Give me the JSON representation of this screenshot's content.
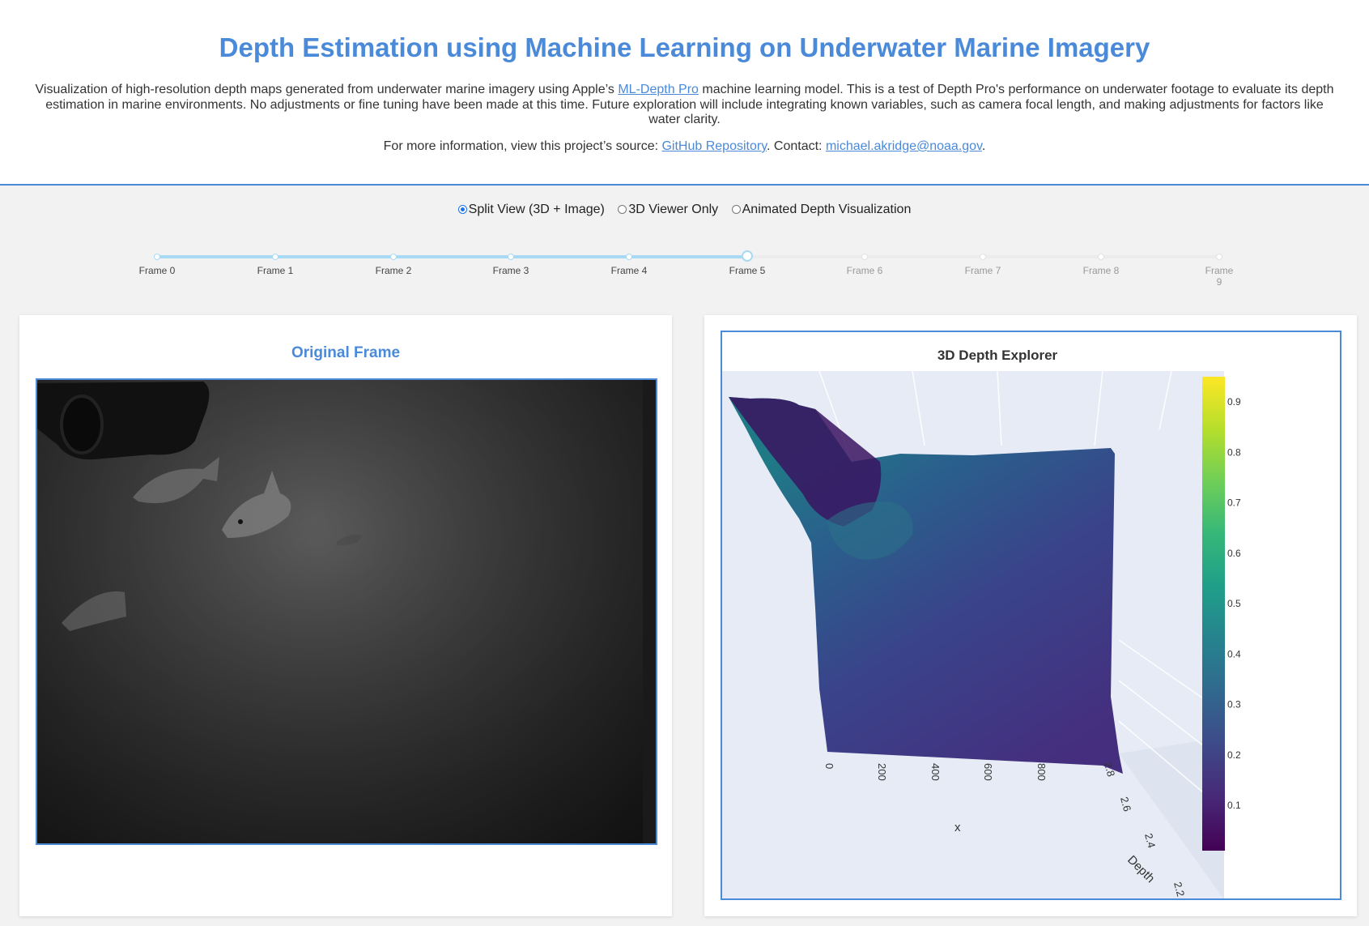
{
  "header": {
    "title": "Depth Estimation using Machine Learning on Underwater Marine Imagery",
    "desc_before": "Visualization of high-resolution depth maps generated from underwater marine imagery using Apple’s ",
    "desc_link": "ML-Depth Pro",
    "desc_after": " machine learning model. This is a test of Depth Pro's performance on underwater footage to evaluate its depth estimation in marine environments. No adjustments or fine tuning have been made at this time. Future exploration will include integrating known variables, such as camera focal length, and making adjustments for factors like water clarity.",
    "info_prefix": "For more information, view this project’s source: ",
    "repo_link": "GitHub Repository",
    "contact_prefix": ". Contact: ",
    "email": "michael.akridge@noaa.gov",
    "info_suffix": "."
  },
  "view_modes": [
    {
      "label": "Split View (3D + Image)",
      "selected": true
    },
    {
      "label": "3D Viewer Only",
      "selected": false
    },
    {
      "label": "Animated Depth Visualization",
      "selected": false
    }
  ],
  "timeline": {
    "frames": [
      "Frame 0",
      "Frame 1",
      "Frame 2",
      "Frame 3",
      "Frame 4",
      "Frame 5",
      "Frame 6",
      "Frame 7",
      "Frame 8",
      "Frame 9"
    ],
    "current": 5
  },
  "left_panel": {
    "title": "Original Frame"
  },
  "right_panel": {
    "title": "3D Depth Explorer",
    "x_axis": {
      "title": "x",
      "ticks": [
        "0",
        "200",
        "400",
        "600",
        "800"
      ]
    },
    "depth_axis": {
      "title": "Depth",
      "ticks": [
        "2.8",
        "2.6",
        "2.4",
        "2.2"
      ]
    },
    "colorbar": {
      "ticks": [
        "0.9",
        "0.8",
        "0.7",
        "0.6",
        "0.5",
        "0.4",
        "0.3",
        "0.2",
        "0.1"
      ],
      "colors": [
        "#fde725",
        "#b5de2b",
        "#6ece58",
        "#35b779",
        "#1f9e89",
        "#26828e",
        "#31688e",
        "#3e4989",
        "#482878",
        "#440154"
      ]
    }
  }
}
